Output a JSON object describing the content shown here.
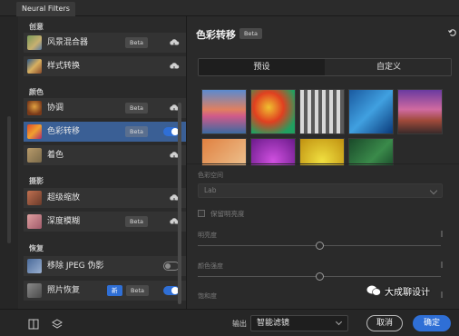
{
  "tab": {
    "label": "Neural Filters"
  },
  "sections": {
    "creative": "创意",
    "color": "颜色",
    "photography": "摄影",
    "restore": "恢复"
  },
  "filters": [
    {
      "label": "风景混合器",
      "beta": "Beta",
      "control": "cloud"
    },
    {
      "label": "样式转换",
      "control": "cloud"
    },
    {
      "label": "协调",
      "beta": "Beta",
      "control": "cloud"
    },
    {
      "label": "色彩转移",
      "beta": "Beta",
      "control": "toggle-on",
      "active": true
    },
    {
      "label": "着色",
      "control": "cloud"
    },
    {
      "label": "超级缩放",
      "control": "cloud"
    },
    {
      "label": "深度模糊",
      "beta": "Beta",
      "control": "cloud"
    },
    {
      "label": "移除 JPEG 伪影",
      "control": "toggle-off"
    },
    {
      "label": "照片恢复",
      "new": "新",
      "beta": "Beta",
      "control": "toggle-on"
    }
  ],
  "detail": {
    "title": "色彩转移",
    "beta": "Beta",
    "tabs": {
      "preset": "预设",
      "custom": "自定义"
    },
    "presets": [
      "sunset-lake",
      "flower-field",
      "gothic-arches",
      "blue-feathers",
      "desert-road",
      "cat-illustration",
      "purple-flowers",
      "yellow-flower",
      "green-leaves"
    ],
    "color_space_label": "色彩空间",
    "color_space_value": "Lab",
    "preserve_luminance_label": "保留明亮度",
    "luminance_label": "明亮度",
    "color_intensity_label": "颜色强度",
    "saturation_label": "饱和度"
  },
  "footer": {
    "output_label": "输出",
    "output_value": "智能滤镜",
    "cancel": "取消",
    "ok": "确定"
  },
  "watermark": "大成聊设计",
  "colors": {
    "accent": "#2f6fd6",
    "panel": "#2a2a2a",
    "active_item": "#3a5f95"
  }
}
